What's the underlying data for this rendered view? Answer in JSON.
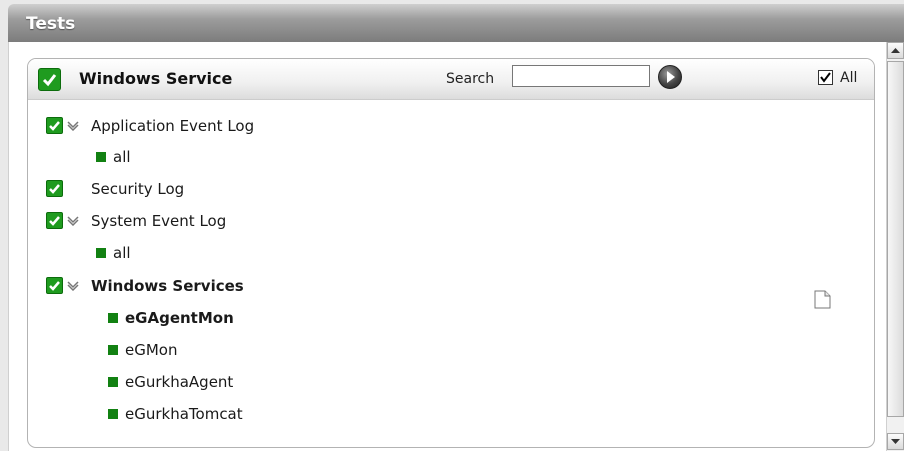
{
  "window": {
    "title": "Tests"
  },
  "panel": {
    "title": "Windows Service",
    "search": {
      "label": "Search",
      "value": "",
      "placeholder": ""
    },
    "all_label": "All",
    "all_checked": true
  },
  "tree": [
    {
      "label": "Application Event Log",
      "checked": true,
      "expanded": true,
      "children": [
        "all"
      ]
    },
    {
      "label": "Security Log",
      "checked": true,
      "expanded": false,
      "children": []
    },
    {
      "label": "System Event Log",
      "checked": true,
      "expanded": true,
      "children": [
        "all"
      ]
    },
    {
      "label": "Windows Services",
      "checked": true,
      "expanded": true,
      "selected": true,
      "children": [
        "eGAgentMon",
        "eGMon",
        "eGurkhaAgent",
        "eGurkhaTomcat"
      ],
      "selected_child": "eGAgentMon"
    }
  ],
  "colors": {
    "check_green": "#1f9b1f",
    "item_green": "#128112",
    "title_bar": "#8a8a8a"
  },
  "icons": {
    "checkbox": "checked-green-icon",
    "expand": "chevron-down-icon",
    "go": "go-arrow-icon",
    "detail": "document-icon"
  }
}
